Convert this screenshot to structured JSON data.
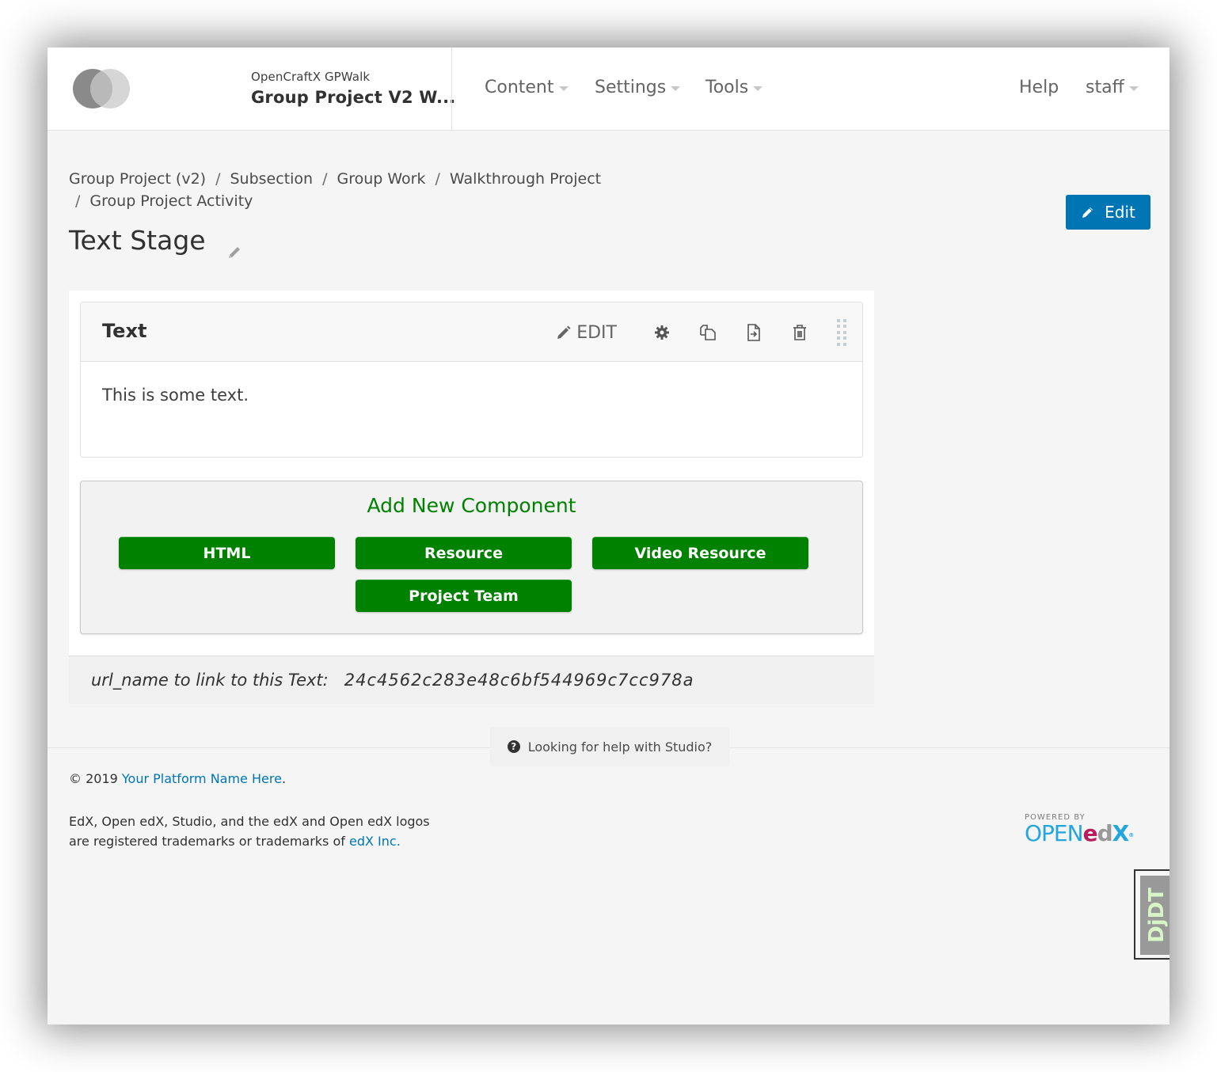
{
  "header": {
    "course_org": "OpenCraftX GPWalk",
    "course_title": "Group Project V2 W...",
    "nav": [
      {
        "label": "Content",
        "dropdown": true
      },
      {
        "label": "Settings",
        "dropdown": true
      },
      {
        "label": "Tools",
        "dropdown": true
      }
    ],
    "help_label": "Help",
    "user_label": "staff"
  },
  "breadcrumb": [
    "Group Project (v2)",
    "Subsection",
    "Group Work",
    "Walkthrough Project",
    "Group Project Activity"
  ],
  "page": {
    "title": "Text Stage",
    "edit_button_label": "Edit"
  },
  "xblock": {
    "title": "Text",
    "edit_label": "EDIT",
    "action_icons": [
      "gear-icon",
      "duplicate-icon",
      "move-icon",
      "delete-icon",
      "drag-handle-icon"
    ],
    "body_text": "This is some text."
  },
  "add_component": {
    "title": "Add New Component",
    "buttons": [
      "HTML",
      "Resource",
      "Video Resource",
      "Project Team"
    ]
  },
  "url_name": {
    "label": "url_name to link to this Text:",
    "value": "24c4562c283e48c6bf544969c7cc978a"
  },
  "footer": {
    "help_text": "Looking for help with Studio?",
    "copyright_prefix": "© 2019 ",
    "platform_link": "Your Platform Name Here",
    "copyright_suffix": ".",
    "trademark_text": "EdX, Open edX, Studio, and the edX and Open edX logos are registered trademarks or trademarks of ",
    "edx_link": "edX Inc.",
    "powered_by": "POWERED BY",
    "logo_open": "OPEN",
    "logo_e": "e",
    "logo_d": "d",
    "logo_x": "X"
  },
  "debug_toolbar": {
    "label": "DjDT"
  },
  "colors": {
    "primary_blue": "#0075b4",
    "component_green": "#008100",
    "text_dark": "#313131"
  }
}
